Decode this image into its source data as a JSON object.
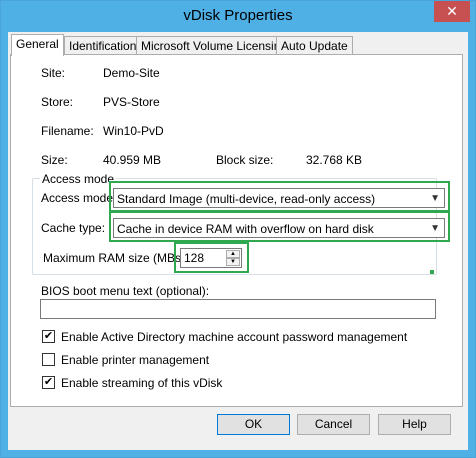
{
  "window": {
    "title": "vDisk Properties",
    "close_glyph": "✕"
  },
  "tabs": [
    {
      "label": "General"
    },
    {
      "label": "Identification"
    },
    {
      "label": "Microsoft Volume Licensing"
    },
    {
      "label": "Auto Update"
    }
  ],
  "general": {
    "site_label": "Site:",
    "site_value": "Demo-Site",
    "store_label": "Store:",
    "store_value": "PVS-Store",
    "filename_label": "Filename:",
    "filename_value": "Win10-PvD",
    "size_label": "Size:",
    "size_value": "40.959 MB",
    "block_size_label": "Block size:",
    "block_size_value": "32.768 KB"
  },
  "access_mode": {
    "group_title": "Access mode",
    "access_label": "Access mode",
    "access_value": "Standard Image (multi-device, read-only access)",
    "cache_label": "Cache type:",
    "cache_value": "Cache in device RAM with overflow on hard disk",
    "ram_label": "Maximum RAM size (MBs):",
    "ram_value": "128"
  },
  "bios": {
    "label": "BIOS boot menu text (optional):",
    "value": ""
  },
  "options": {
    "ad_label": "Enable Active Directory machine account password management",
    "ad_checked": true,
    "printer_label": "Enable printer management",
    "printer_checked": false,
    "streaming_label": "Enable streaming of this vDisk",
    "streaming_checked": true
  },
  "buttons": {
    "ok": "OK",
    "cancel": "Cancel",
    "help": "Help"
  },
  "colors": {
    "title_bar": "#4fb0e6",
    "highlight": "#2fa84f",
    "close_button": "#c75050"
  }
}
